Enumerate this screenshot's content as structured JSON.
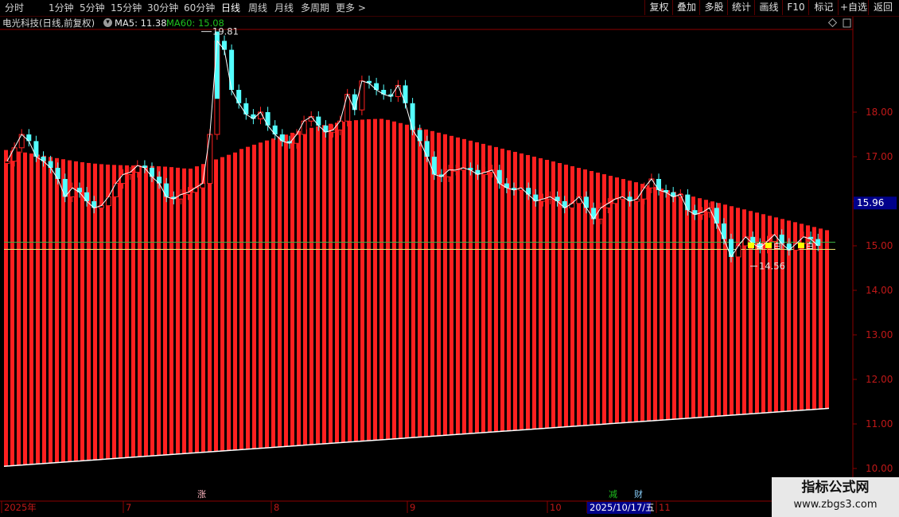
{
  "toolbar": {
    "periods": [
      "分时",
      "1分钟",
      "5分钟",
      "15分钟",
      "30分钟",
      "60分钟",
      "日线",
      "周线",
      "月线",
      "多周期",
      "更多"
    ],
    "active_period": "日线",
    "right_buttons": [
      "复权",
      "叠加",
      "多股",
      "统计",
      "画线",
      "F10",
      "+自选",
      "返回"
    ]
  },
  "info": {
    "stock_title": "电光科技(日线,前复权)",
    "ma5_label": "MA5: 11.38",
    "ma60_label": "MA60: 15.08"
  },
  "colors": {
    "background": "#000000",
    "up_red": "#ff2020",
    "down_cyan": "#54ffff",
    "grid_red": "#8b0000",
    "ma5_white": "#ffffff",
    "ma60_green": "#00c000",
    "price_label_bg": "#00008b",
    "signal_yellow": "#ffff00"
  },
  "chart_data": {
    "type": "candlestick",
    "y_ticks": [
      "18.00",
      "17.00",
      "16.00",
      "15.00",
      "14.00",
      "13.00",
      "12.00",
      "11.00",
      "10.00"
    ],
    "ylim": [
      9.9,
      20.05
    ],
    "x_labels": [
      "2025年",
      "7",
      "8",
      "9",
      "10",
      "2025/10/17/五",
      "11"
    ],
    "current_price_label": "15.96",
    "high_annotation": "19.81",
    "low_annotation": "14.56",
    "reference_lines": [
      15.08,
      14.92
    ],
    "event_markers": [
      "涨",
      "减",
      "财"
    ],
    "signal_labels": [
      "白",
      "白",
      "白"
    ],
    "bar_series": {
      "name": "",
      "top_start": 17.1,
      "top_peak": 17.85,
      "top_end": 15.35,
      "bottom_start": 10.05,
      "bottom_end": 11.35
    },
    "closes": [
      16.9,
      17.2,
      17.5,
      17.35,
      17.0,
      16.9,
      16.75,
      16.5,
      16.1,
      16.3,
      16.2,
      16.0,
      15.85,
      15.9,
      16.1,
      16.4,
      16.6,
      16.65,
      16.8,
      16.75,
      16.55,
      16.4,
      16.1,
      16.05,
      16.15,
      16.2,
      16.3,
      16.4,
      17.5,
      19.6,
      19.4,
      18.5,
      18.2,
      17.95,
      17.85,
      18.0,
      17.7,
      17.5,
      17.35,
      17.3,
      17.5,
      17.8,
      17.9,
      17.7,
      17.55,
      17.6,
      17.8,
      18.4,
      18.05,
      18.7,
      18.65,
      18.5,
      18.4,
      18.35,
      18.6,
      18.2,
      17.6,
      17.35,
      17.0,
      16.6,
      16.55,
      16.7,
      16.7,
      16.75,
      16.7,
      16.6,
      16.65,
      16.7,
      16.4,
      16.3,
      16.25,
      16.3,
      16.15,
      16.0,
      16.05,
      16.1,
      16.0,
      15.85,
      15.95,
      16.1,
      15.85,
      15.6,
      15.85,
      15.95,
      16.05,
      16.1,
      16.0,
      16.05,
      16.3,
      16.5,
      16.25,
      16.2,
      16.1,
      16.15,
      15.8,
      15.7,
      15.75,
      15.85,
      15.5,
      15.15,
      14.75,
      15.0,
      15.2,
      15.05,
      14.95,
      15.1,
      15.25,
      15.05,
      14.9,
      15.05,
      15.2,
      15.15,
      15.0
    ]
  },
  "watermark": {
    "title": "指标公式网",
    "url": "www.zbgs3.com"
  }
}
